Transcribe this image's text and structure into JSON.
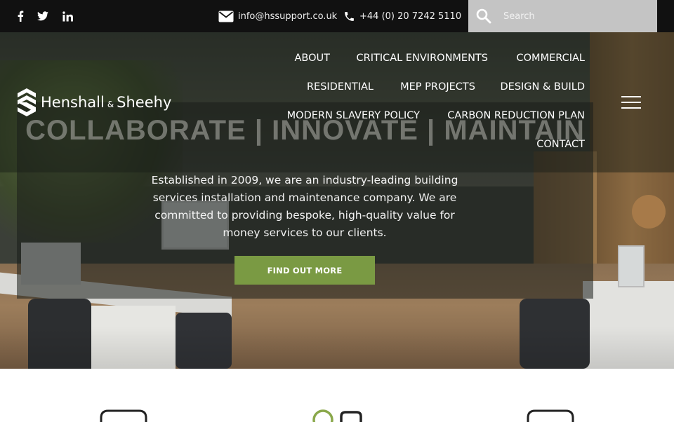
{
  "topbar": {
    "social": [
      {
        "name": "facebook-icon"
      },
      {
        "name": "twitter-icon"
      },
      {
        "name": "linkedin-icon"
      }
    ],
    "email": "info@hssupport.co.uk",
    "phone": "+44 (0) 20 7242 5110",
    "search": {
      "placeholder": "Search"
    }
  },
  "brand": {
    "name_part1": "Henshall",
    "amp": "&",
    "name_part2": "Sheehy"
  },
  "nav": {
    "items": [
      "ABOUT",
      "CRITICAL ENVIRONMENTS",
      "COMMERCIAL",
      "RESIDENTIAL",
      "MEP PROJECTS",
      "DESIGN & BUILD",
      "MODERN SLAVERY POLICY",
      "CARBON REDUCTION PLAN",
      "CONTACT"
    ]
  },
  "hero": {
    "tagline": "COLLABORATE | INNOVATE | MAINTAIN",
    "intro": "Established in 2009, we are an industry-leading building services installation and maintenance company. We are committed to providing bespoke, high-quality value for money services to our clients.",
    "cta": "FIND OUT MORE"
  },
  "colors": {
    "topbar_bg": "#111111",
    "accent_green": "#7a9a43",
    "search_bg": "#c4c4c4"
  }
}
